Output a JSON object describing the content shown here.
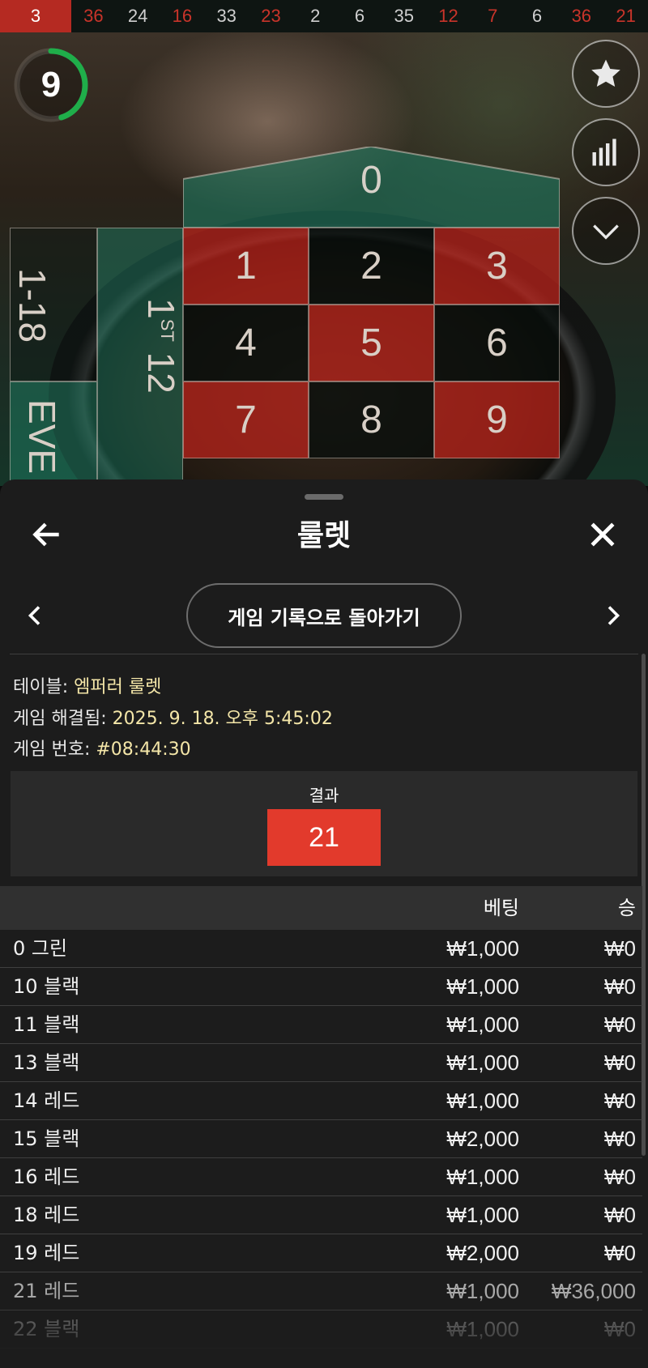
{
  "history": [
    {
      "n": "3",
      "color": "red",
      "latest": true
    },
    {
      "n": "36",
      "color": "red"
    },
    {
      "n": "24",
      "color": "black"
    },
    {
      "n": "16",
      "color": "red"
    },
    {
      "n": "33",
      "color": "black"
    },
    {
      "n": "23",
      "color": "red"
    },
    {
      "n": "2",
      "color": "black"
    },
    {
      "n": "6",
      "color": "black"
    },
    {
      "n": "35",
      "color": "black"
    },
    {
      "n": "12",
      "color": "red"
    },
    {
      "n": "7",
      "color": "red"
    },
    {
      "n": "6",
      "color": "black"
    },
    {
      "n": "36",
      "color": "red"
    },
    {
      "n": "21",
      "color": "red"
    }
  ],
  "timer": {
    "value": "9",
    "progress": 0.45
  },
  "side_buttons": [
    "star-icon",
    "stats-icon",
    "chevron-down-icon"
  ],
  "board": {
    "zero": "0",
    "cells": [
      {
        "n": "1",
        "color": "red"
      },
      {
        "n": "2",
        "color": "black"
      },
      {
        "n": "3",
        "color": "red"
      },
      {
        "n": "4",
        "color": "black"
      },
      {
        "n": "5",
        "color": "red"
      },
      {
        "n": "6",
        "color": "black"
      },
      {
        "n": "7",
        "color": "red"
      },
      {
        "n": "8",
        "color": "black"
      },
      {
        "n": "9",
        "color": "red"
      }
    ],
    "low_label": "1-18",
    "even_label": "EVE",
    "dozen_num": "1",
    "dozen_suffix": "ST",
    "dozen_count": "12"
  },
  "sheet": {
    "title": "룰렛",
    "return_button": "게임 기록으로 돌아가기",
    "table_label": "테이블:",
    "table_value": "엠퍼러 룰렛",
    "resolved_label": "게임 해결됨:",
    "resolved_value": "2025. 9. 18. 오후 5:45:02",
    "game_no_label": "게임 번호:",
    "game_no_value": "#08:44:30",
    "result_label": "결과",
    "result_value": "21",
    "result_color": "#e23a2c",
    "columns": {
      "bet": "베팅",
      "win": "승"
    },
    "rows": [
      {
        "name": "0 그린",
        "bet": "₩1,000",
        "win": "₩0"
      },
      {
        "name": "10 블랙",
        "bet": "₩1,000",
        "win": "₩0"
      },
      {
        "name": "11 블랙",
        "bet": "₩1,000",
        "win": "₩0"
      },
      {
        "name": "13 블랙",
        "bet": "₩1,000",
        "win": "₩0"
      },
      {
        "name": "14 레드",
        "bet": "₩1,000",
        "win": "₩0"
      },
      {
        "name": "15 블랙",
        "bet": "₩2,000",
        "win": "₩0"
      },
      {
        "name": "16 레드",
        "bet": "₩1,000",
        "win": "₩0"
      },
      {
        "name": "18 레드",
        "bet": "₩1,000",
        "win": "₩0"
      },
      {
        "name": "19 레드",
        "bet": "₩2,000",
        "win": "₩0"
      },
      {
        "name": "21 레드",
        "bet": "₩1,000",
        "win": "₩36,000",
        "dim": true
      },
      {
        "name": "22 블랙",
        "bet": "₩1,000",
        "win": "₩0",
        "faded": true
      }
    ]
  }
}
